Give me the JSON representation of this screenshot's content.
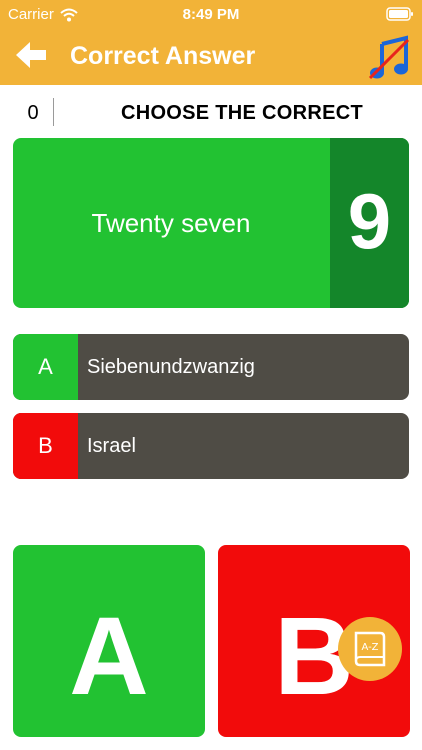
{
  "status_bar": {
    "carrier": "Carrier",
    "time": "8:49 PM"
  },
  "nav": {
    "title": "Correct Answer",
    "back_icon": "arrow-left-icon",
    "music_icon": "music-off-icon"
  },
  "game": {
    "score": "0",
    "instruction": "CHOOSE THE CORRECT",
    "question": "Twenty seven",
    "timer": "9"
  },
  "options": [
    {
      "letter": "A",
      "text": "Siebenundzwanzig",
      "color": "#22c232"
    },
    {
      "letter": "B",
      "text": "Israel",
      "color": "#f20b0b"
    }
  ],
  "answer_buttons": [
    {
      "letter": "A",
      "color": "#22c232"
    },
    {
      "letter": "B",
      "color": "#f20b0b"
    }
  ],
  "dictionary": {
    "label": "A-Z",
    "icon": "dictionary-book-icon"
  },
  "colors": {
    "accent": "#f2b338",
    "option_bar": "#4f4c45",
    "timer_bg": "#14862a"
  }
}
